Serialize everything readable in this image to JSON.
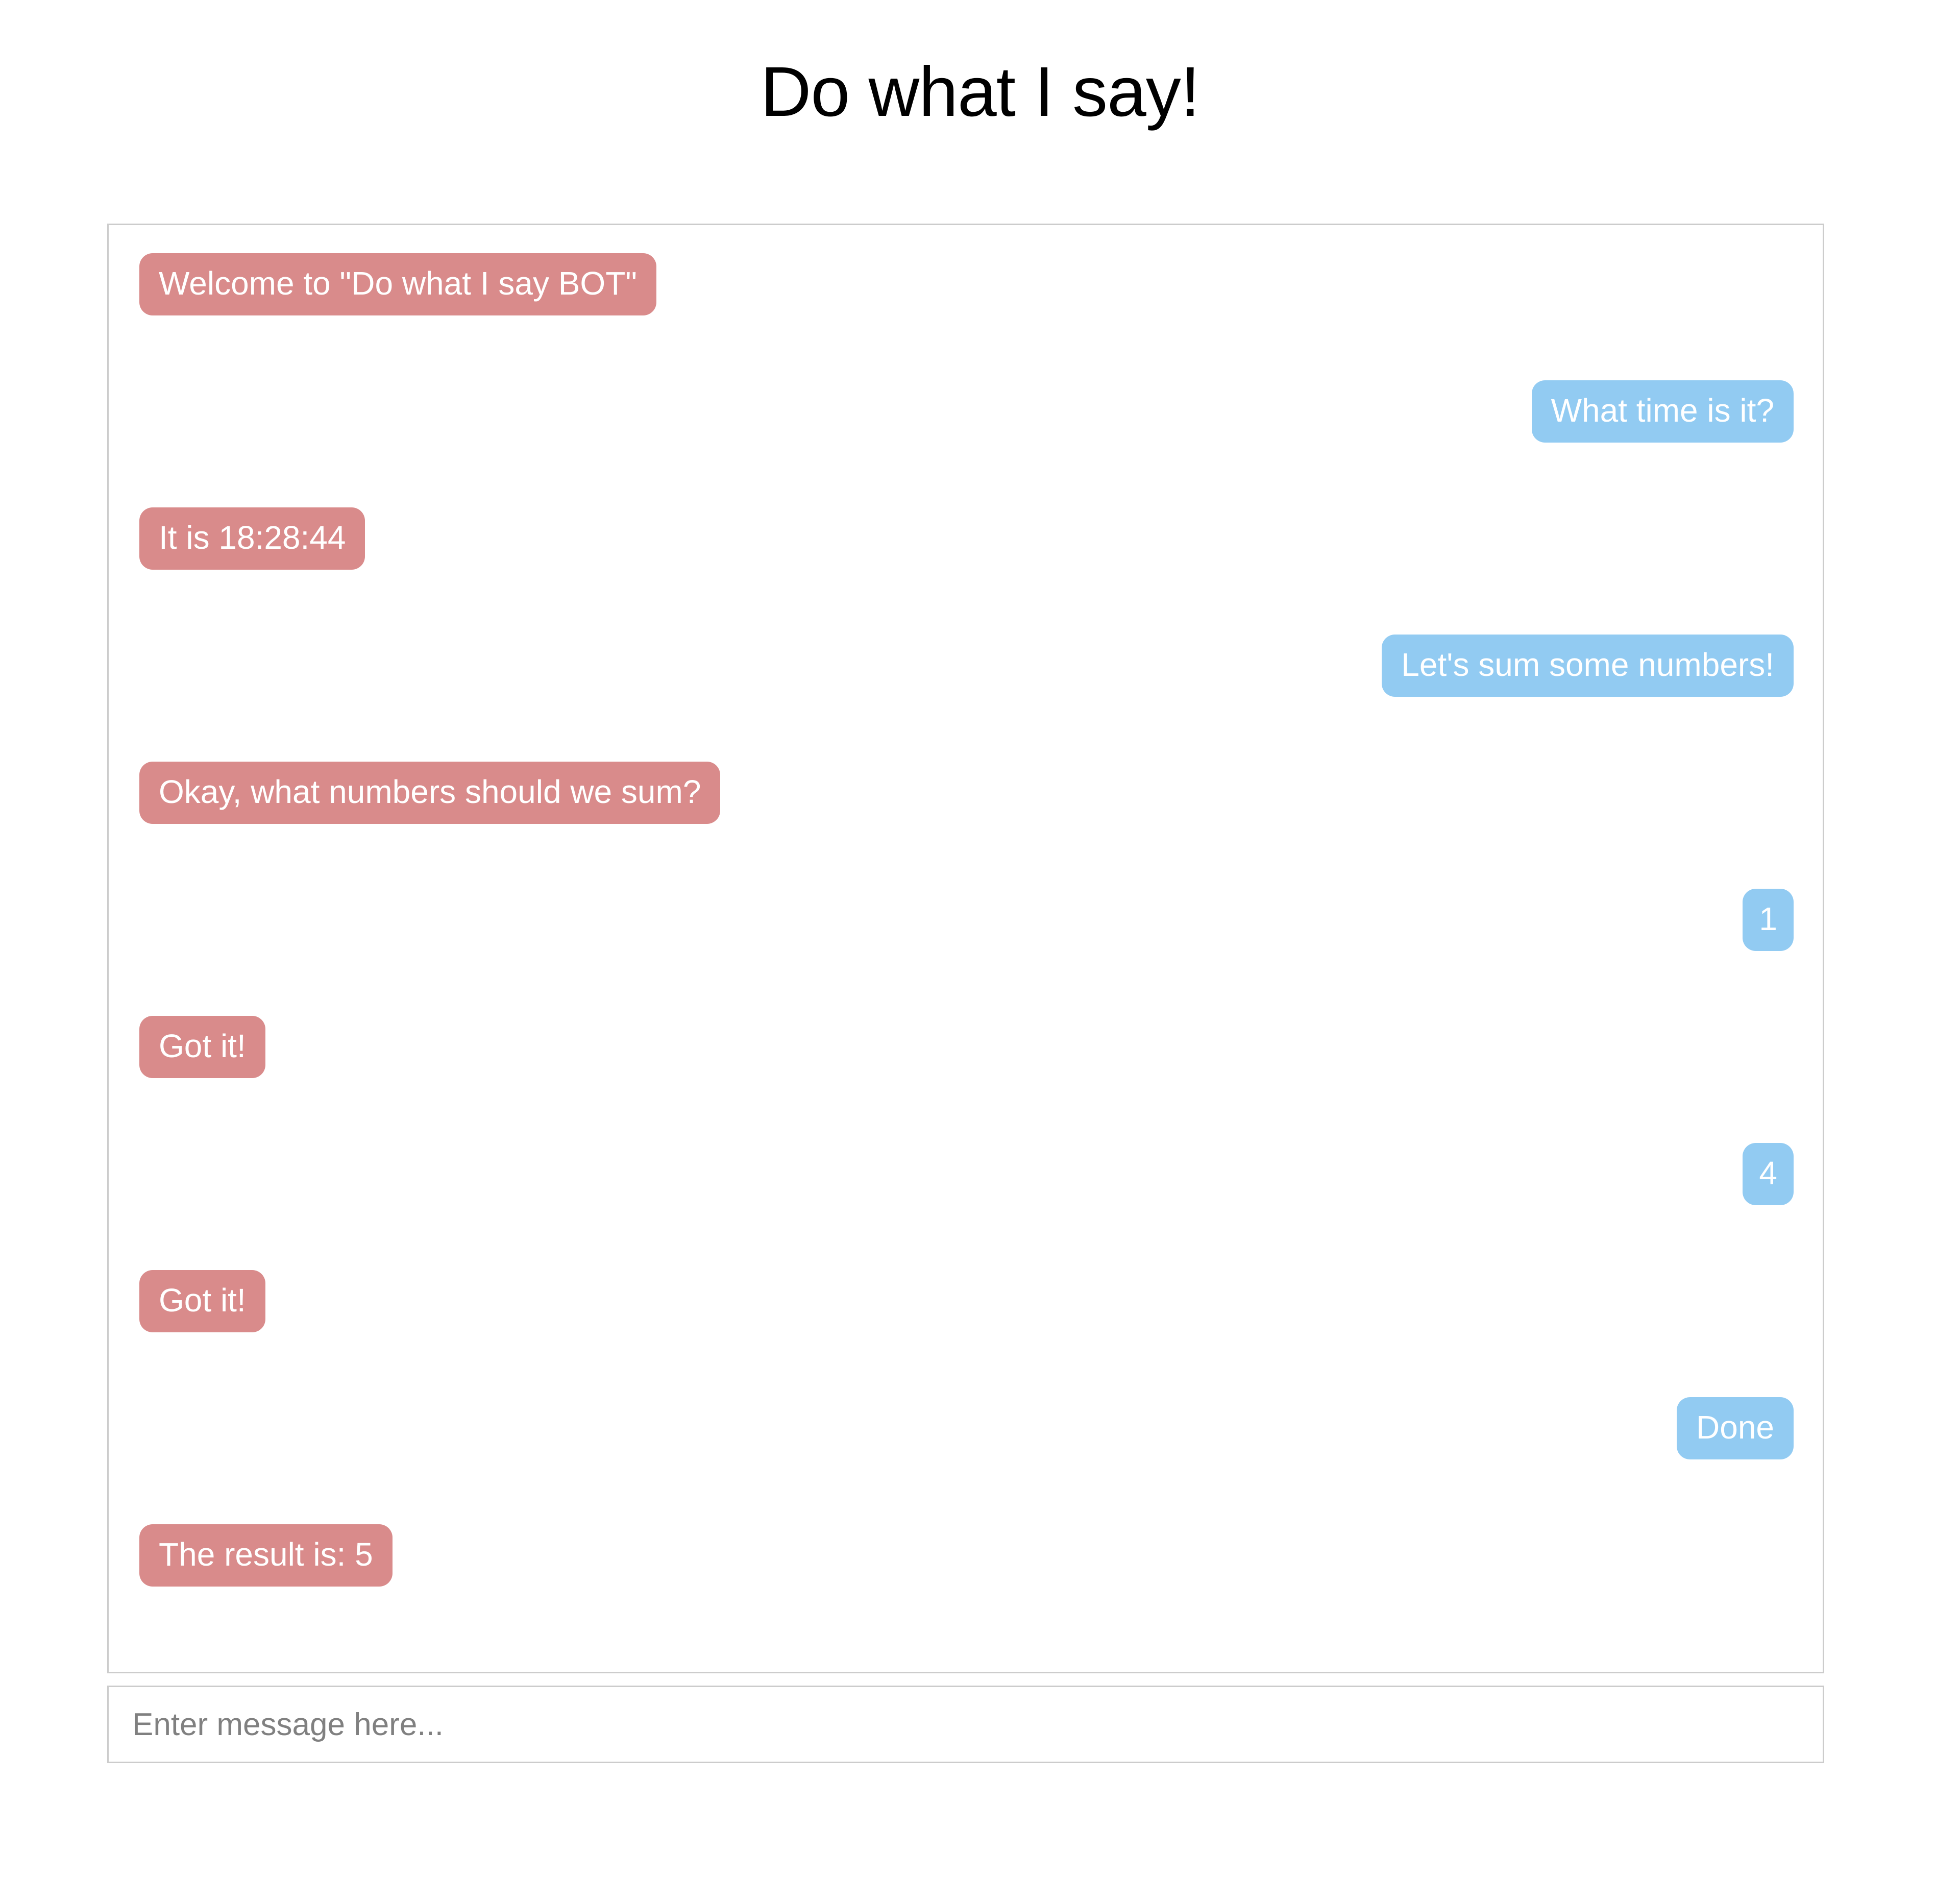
{
  "app": {
    "title": "Do what I say!",
    "colors": {
      "bot_bubble": "#d98b8b",
      "user_bubble": "#92cbf2",
      "bubble_text": "#ffffff",
      "panel_border": "#cccccc",
      "title_text": "#000000",
      "placeholder_text": "#808080"
    }
  },
  "chat": {
    "messages": [
      {
        "sender": "bot",
        "text": "Welcome to \"Do what I say BOT\""
      },
      {
        "sender": "user",
        "text": "What time is it?"
      },
      {
        "sender": "bot",
        "text": "It is 18:28:44"
      },
      {
        "sender": "user",
        "text": "Let's sum some numbers!"
      },
      {
        "sender": "bot",
        "text": "Okay, what numbers should we sum?"
      },
      {
        "sender": "user",
        "text": "1"
      },
      {
        "sender": "bot",
        "text": "Got it!"
      },
      {
        "sender": "user",
        "text": "4"
      },
      {
        "sender": "bot",
        "text": "Got it!"
      },
      {
        "sender": "user",
        "text": "Done"
      },
      {
        "sender": "bot",
        "text": "The result is: 5"
      }
    ]
  },
  "composer": {
    "placeholder": "Enter message here...",
    "value": ""
  }
}
